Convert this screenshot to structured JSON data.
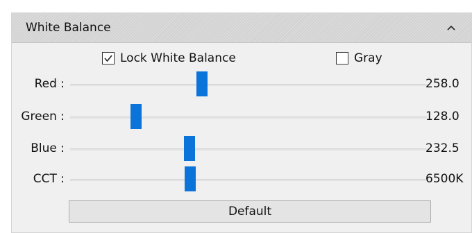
{
  "panel": {
    "title": "White Balance",
    "collapse_icon": "chevron-up-icon"
  },
  "options": {
    "lock_white_balance": {
      "label": "Lock White Balance",
      "checked": true
    },
    "gray": {
      "label": "Gray",
      "checked": false
    }
  },
  "sliders": [
    {
      "label": "Red :",
      "value": "258.0",
      "position": 0.37
    },
    {
      "label": "Green :",
      "value": "128.0",
      "position": 0.185
    },
    {
      "label": "Blue :",
      "value": "232.5",
      "position": 0.335
    },
    {
      "label": "CCT :",
      "value": "6500K",
      "position": 0.337
    }
  ],
  "buttons": {
    "default_label": "Default"
  },
  "colors": {
    "accent": "#0a74da",
    "panel_bg": "#f0f0f0",
    "header_bg": "#d2d2d2"
  }
}
